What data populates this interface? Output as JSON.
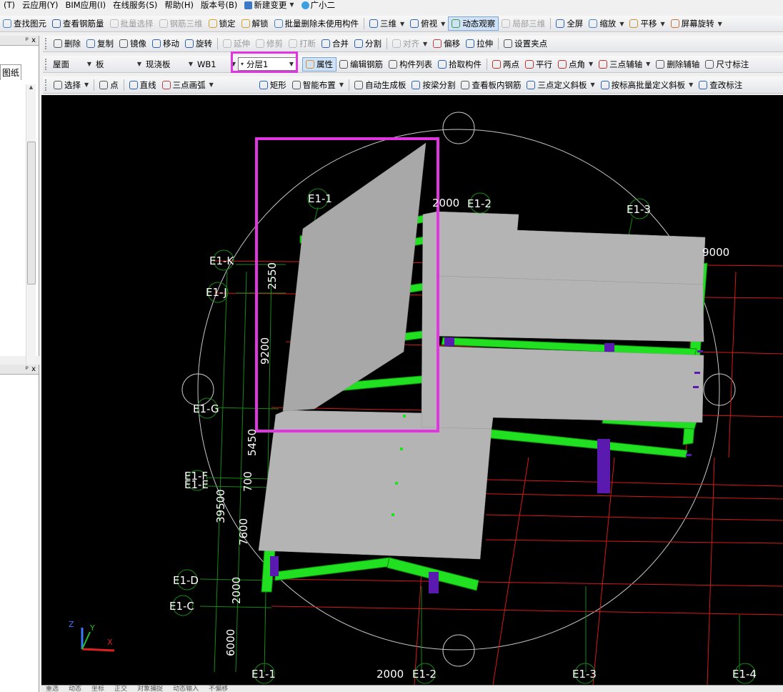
{
  "menu": [
    "(T)",
    "云应用(Y)",
    "BIM应用(I)",
    "在线服务(S)",
    "帮助(H)",
    "版本号(B)",
    "新建变更",
    "广小二"
  ],
  "toolbar1": [
    {
      "label": "查找图元",
      "icon": "find-icon",
      "disabled": false,
      "dropdown": false
    },
    {
      "label": "查看钢筋量",
      "icon": "rebar-qty-icon",
      "disabled": false,
      "dropdown": false
    },
    {
      "label": "批量选择",
      "icon": "batch-select-icon",
      "disabled": true,
      "dropdown": false
    },
    {
      "label": "钢筋三维",
      "icon": "rebar-3d-icon",
      "disabled": true,
      "dropdown": false
    },
    {
      "label": "锁定",
      "icon": "lock-icon",
      "disabled": false,
      "dropdown": false
    },
    {
      "label": "解锁",
      "icon": "unlock-icon",
      "disabled": false,
      "dropdown": false
    },
    {
      "label": "批量删除未使用构件",
      "icon": "batch-delete-icon",
      "disabled": false,
      "dropdown": false
    },
    {
      "label": "三维",
      "icon": "cube-3d-icon",
      "disabled": false,
      "dropdown": true
    },
    {
      "label": "俯视",
      "icon": "top-view-icon",
      "disabled": false,
      "dropdown": true
    },
    {
      "label": "动态观察",
      "icon": "orbit-icon",
      "disabled": false,
      "dropdown": false,
      "active": true
    },
    {
      "label": "局部三维",
      "icon": "local-3d-icon",
      "disabled": true,
      "dropdown": false
    },
    {
      "label": "全屏",
      "icon": "fullscreen-icon",
      "disabled": false,
      "dropdown": false
    },
    {
      "label": "缩放",
      "icon": "zoom-icon",
      "disabled": false,
      "dropdown": true
    },
    {
      "label": "平移",
      "icon": "pan-icon",
      "disabled": false,
      "dropdown": true
    },
    {
      "label": "屏幕旋转",
      "icon": "screen-rotate-icon",
      "disabled": false,
      "dropdown": true
    }
  ],
  "toolbar2": [
    {
      "label": "删除",
      "icon": "delete-icon",
      "disabled": false
    },
    {
      "label": "复制",
      "icon": "copy-icon",
      "disabled": false
    },
    {
      "label": "镜像",
      "icon": "mirror-icon",
      "disabled": false
    },
    {
      "label": "移动",
      "icon": "move-icon",
      "disabled": false
    },
    {
      "label": "旋转",
      "icon": "rotate-icon",
      "disabled": false
    },
    {
      "label": "延伸",
      "icon": "extend-icon",
      "disabled": true
    },
    {
      "label": "修剪",
      "icon": "trim-icon",
      "disabled": true
    },
    {
      "label": "打断",
      "icon": "break-icon",
      "disabled": true
    },
    {
      "label": "合并",
      "icon": "merge-icon",
      "disabled": false
    },
    {
      "label": "分割",
      "icon": "split-icon",
      "disabled": false
    },
    {
      "label": "对齐",
      "icon": "align-icon",
      "disabled": true,
      "dropdown": true
    },
    {
      "label": "偏移",
      "icon": "offset-icon",
      "disabled": false
    },
    {
      "label": "拉伸",
      "icon": "stretch-icon",
      "disabled": false
    },
    {
      "label": "设置夹点",
      "icon": "grip-point-icon",
      "disabled": false
    }
  ],
  "toolbar3": {
    "selects": [
      {
        "name": "floor-select",
        "value": "屋面"
      },
      {
        "name": "category-select",
        "value": "板"
      },
      {
        "name": "type-select",
        "value": "现浇板"
      },
      {
        "name": "component-select",
        "value": "WB1"
      },
      {
        "name": "layer-select",
        "value": "分层1"
      }
    ],
    "buttons": [
      {
        "label": "属性",
        "icon": "properties-icon",
        "active": true
      },
      {
        "label": "编辑钢筋",
        "icon": "edit-rebar-icon"
      },
      {
        "label": "构件列表",
        "icon": "component-list-icon"
      },
      {
        "label": "拾取构件",
        "icon": "pick-component-icon"
      },
      {
        "label": "两点",
        "icon": "two-point-icon"
      },
      {
        "label": "平行",
        "icon": "parallel-icon"
      },
      {
        "label": "点角",
        "icon": "point-angle-icon",
        "dropdown": true
      },
      {
        "label": "三点辅轴",
        "icon": "three-point-axis-icon",
        "dropdown": true
      },
      {
        "label": "删除辅轴",
        "icon": "delete-axis-icon"
      },
      {
        "label": "尺寸标注",
        "icon": "dimension-icon"
      }
    ]
  },
  "toolbar4": [
    {
      "label": "选择",
      "icon": "select-arrow-icon",
      "dropdown": true
    },
    {
      "label": "点",
      "icon": "point-icon"
    },
    {
      "label": "直线",
      "icon": "line-icon"
    },
    {
      "label": "三点画弧",
      "icon": "arc-icon",
      "dropdown": true
    },
    {
      "label": "矩形",
      "icon": "rectangle-icon"
    },
    {
      "label": "智能布置",
      "icon": "smart-layout-icon",
      "dropdown": true
    },
    {
      "label": "自动生成板",
      "icon": "auto-slab-icon"
    },
    {
      "label": "按梁分割",
      "icon": "split-by-beam-icon"
    },
    {
      "label": "查看板内钢筋",
      "icon": "view-slab-rebar-icon"
    },
    {
      "label": "三点定义斜板",
      "icon": "three-point-slope-icon",
      "dropdown": true
    },
    {
      "label": "按标高批量定义斜板",
      "icon": "batch-slope-icon",
      "dropdown": true
    },
    {
      "label": "查改标注",
      "icon": "edit-annotation-icon"
    }
  ],
  "left_panel": {
    "pin": "ᵖ",
    "close": "x",
    "tab": "图纸"
  },
  "viewport": {
    "axis_labels_top": [
      "E1-1",
      "E1-2",
      "E1-3"
    ],
    "axis_labels_bottom": [
      "E1-1",
      "E1-2",
      "E1-3",
      "E1-4"
    ],
    "axis_labels_left": [
      "E1-K",
      "E1-J",
      "E1-G",
      "E1-F",
      "E1-E",
      "E1-D",
      "E1-C"
    ],
    "dimensions": [
      "2000",
      "9000",
      "2550",
      "9200",
      "5450",
      "700",
      "39500",
      "7600",
      "2000",
      "6000",
      "2000"
    ],
    "gizmo": {
      "z": "Z",
      "y": "Y",
      "x": "X"
    }
  },
  "status": [
    "重选",
    "动态",
    "坐标",
    "正交",
    "对象捕捉",
    "动态输入",
    "不偏移"
  ],
  "colors": {
    "beam": "#21e021",
    "column": "#5a1ab0",
    "slab": "#b4b4b4",
    "grid_red": "#d81818",
    "grid_green": "#138a13",
    "highlight": "#e235e2"
  }
}
